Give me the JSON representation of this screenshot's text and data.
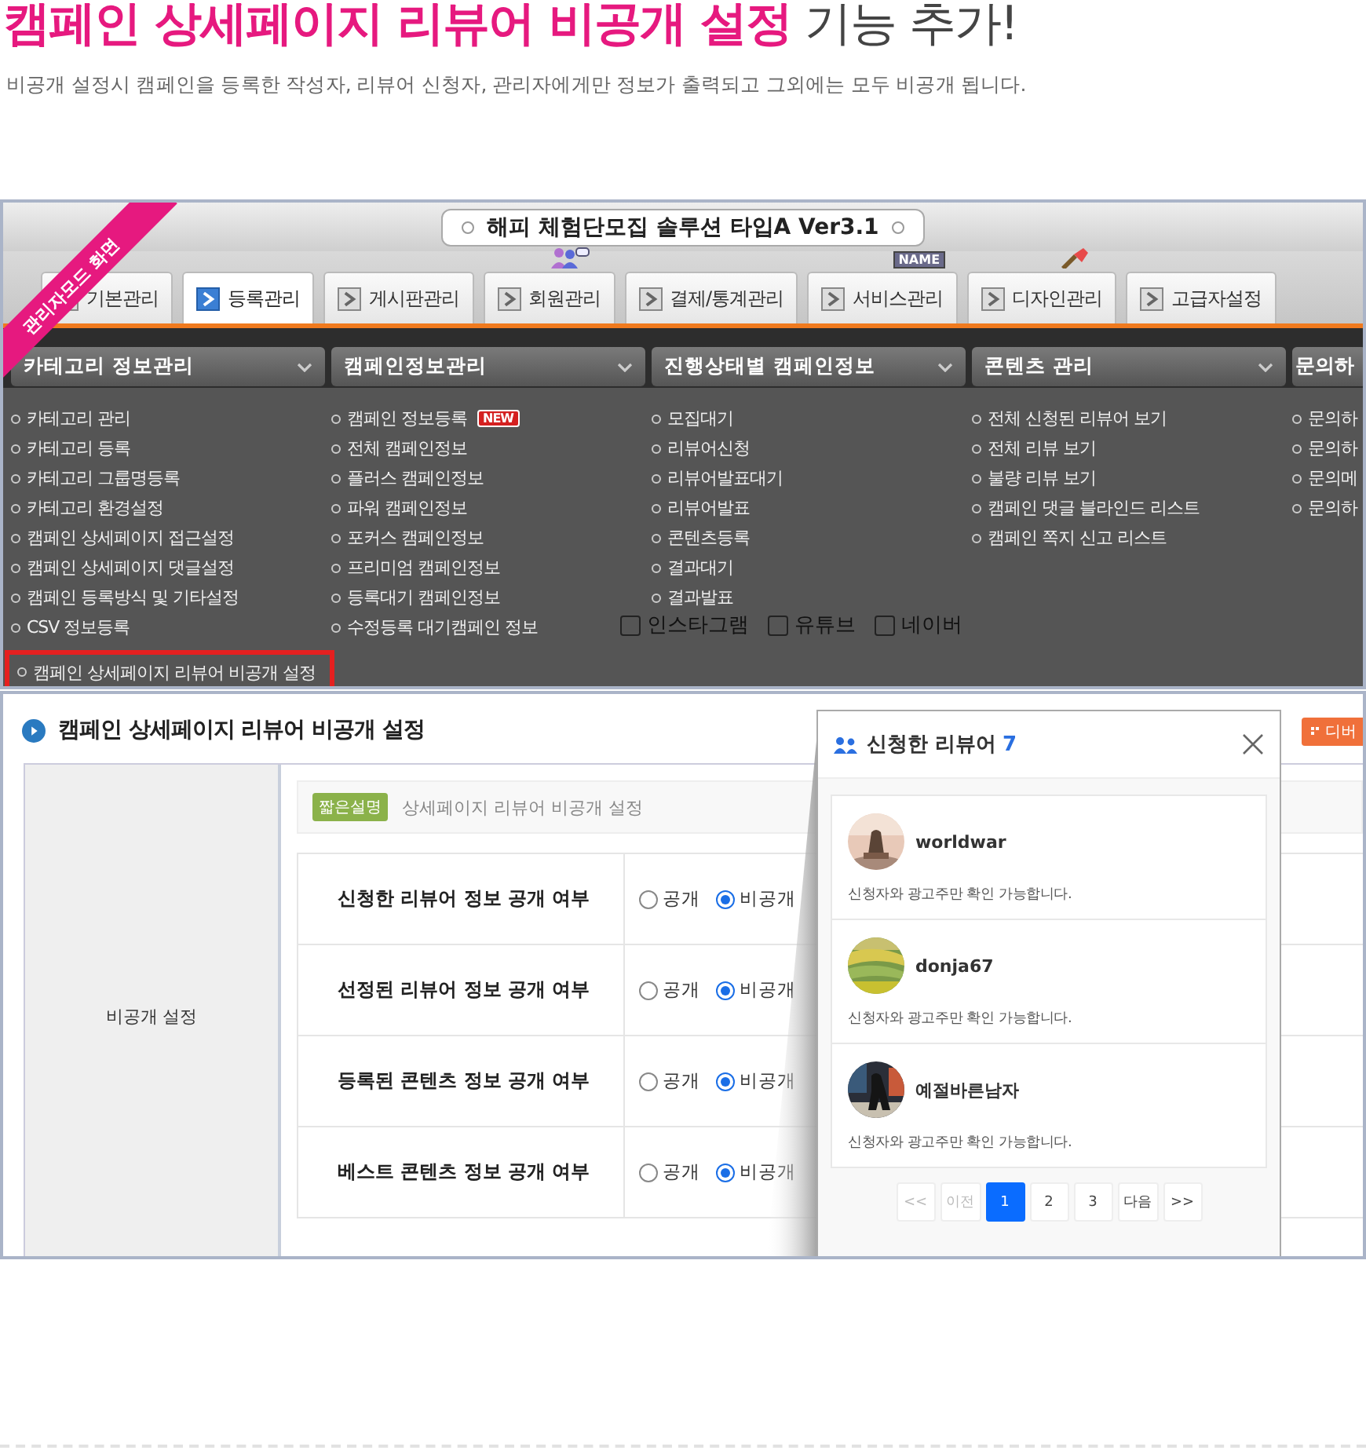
{
  "headline": {
    "highlight": "캠페인 상세페이지 리뷰어 비공개 설정",
    "rest": "기능 추가!"
  },
  "subtitle": "비공개 설정시 캠페인을 등록한 작성자, 리뷰어 신청자, 관리자에게만 정보가 출력되고 그외에는 모두 비공개 됩니다.",
  "admin_screen": {
    "ribbon": "관리자모드 화면",
    "title": "해피 체험단모집 솔루션 타입A Ver3.1",
    "tabs": [
      {
        "label": "기본관리",
        "selected": false
      },
      {
        "label": "등록관리",
        "selected": true
      },
      {
        "label": "게시판관리",
        "selected": false
      },
      {
        "label": "회원관리",
        "selected": false,
        "kind": "people"
      },
      {
        "label": "결제/통계관리",
        "selected": false
      },
      {
        "label": "서비스관리",
        "selected": false,
        "kind": "name_tag",
        "tag": "NAME"
      },
      {
        "label": "디자인관리",
        "selected": false,
        "kind": "brush"
      },
      {
        "label": "고급자설정",
        "selected": false
      }
    ],
    "menu": [
      {
        "heading": "카테고리 정보관리",
        "items": [
          {
            "label": "카테고리 관리",
            "highlighted": false
          },
          {
            "label": "카테고리 등록",
            "highlighted": false
          },
          {
            "label": "카테고리 그룹명등록",
            "highlighted": false
          },
          {
            "label": "카테고리 환경설정",
            "highlighted": false
          },
          {
            "label": "캠페인 상세페이지 접근설정",
            "highlighted": false
          },
          {
            "label": "캠페인 상세페이지 댓글설정",
            "highlighted": false
          },
          {
            "label": "캠페인 등록방식 및 기타설정",
            "highlighted": false
          },
          {
            "label": "CSV 정보등록",
            "highlighted": false
          },
          {
            "label": "캠페인 상세페이지 리뷰어 비공개 설정",
            "highlighted": true
          }
        ]
      },
      {
        "heading": "캠페인정보관리",
        "items": [
          {
            "label": "캠페인 정보등록",
            "highlighted": false,
            "badge": "NEW"
          },
          {
            "label": "전체 캠페인정보",
            "highlighted": false
          },
          {
            "label": "플러스 캠페인정보",
            "highlighted": false
          },
          {
            "label": "파워 캠페인정보",
            "highlighted": false
          },
          {
            "label": "포커스 캠페인정보",
            "highlighted": false
          },
          {
            "label": "프리미엄 캠페인정보",
            "highlighted": false
          },
          {
            "label": "등록대기 캠페인정보",
            "highlighted": false
          },
          {
            "label": "수정등록 대기캠페인 정보",
            "highlighted": false
          }
        ]
      },
      {
        "heading": "진행상태별 캠페인정보",
        "items": [
          {
            "label": "모집대기",
            "highlighted": false
          },
          {
            "label": "리뷰어신청",
            "highlighted": false
          },
          {
            "label": "리뷰어발표대기",
            "highlighted": false
          },
          {
            "label": "리뷰어발표",
            "highlighted": false
          },
          {
            "label": "콘텐츠등록",
            "highlighted": false
          },
          {
            "label": "결과대기",
            "highlighted": false
          },
          {
            "label": "결과발표",
            "highlighted": false
          }
        ]
      },
      {
        "heading": "콘텐츠 관리",
        "items": [
          {
            "label": "전체 신청된 리뷰어 보기",
            "highlighted": false
          },
          {
            "label": "전체 리뷰 보기",
            "highlighted": false
          },
          {
            "label": "불량 리뷰 보기",
            "highlighted": false
          },
          {
            "label": "캠페인 댓글 블라인드 리스트",
            "highlighted": false
          },
          {
            "label": "캠페인 쪽지 신고 리스트",
            "highlighted": false
          }
        ]
      },
      {
        "heading": "문의하",
        "items": [
          {
            "label": "문의하",
            "highlighted": false
          },
          {
            "label": "문의하",
            "highlighted": false
          },
          {
            "label": "문의메",
            "highlighted": false
          },
          {
            "label": "문의하",
            "highlighted": false
          }
        ]
      }
    ],
    "underlay_checkboxes": [
      {
        "label": "인스타그램",
        "checked": false
      },
      {
        "label": "유튜브",
        "checked": false
      },
      {
        "label": "네이버",
        "checked": false
      }
    ]
  },
  "settings_screen": {
    "title": "캠페인 상세페이지 리뷰어 비공개 설정",
    "corner_button": "디버",
    "side_label": "비공개 설정",
    "note_badge": "짧은설명",
    "note": "상세페이지 리뷰어 비공개 설정",
    "rows": [
      {
        "label": "신청한 리뷰어 정보 공개 여부",
        "options": [
          {
            "label": "공개",
            "selected": false
          },
          {
            "label": "비공개",
            "selected": true
          }
        ]
      },
      {
        "label": "선정된 리뷰어 정보 공개 여부",
        "options": [
          {
            "label": "공개",
            "selected": false
          },
          {
            "label": "비공개",
            "selected": true
          }
        ]
      },
      {
        "label": "등록된 콘텐츠 정보 공개 여부",
        "options": [
          {
            "label": "공개",
            "selected": false
          },
          {
            "label": "비공개",
            "selected": true
          }
        ]
      },
      {
        "label": "베스트 콘텐츠 정보 공개 여부",
        "options": [
          {
            "label": "공개",
            "selected": false
          },
          {
            "label": "비공개",
            "selected": true
          }
        ]
      }
    ]
  },
  "popup": {
    "title": "신청한 리뷰어",
    "count": "7",
    "reviewers": [
      {
        "name": "worldwar",
        "note": "신청자와 광고주만 확인 가능합니다."
      },
      {
        "name": "donja67",
        "note": "신청자와 광고주만 확인 가능합니다."
      },
      {
        "name": "예절바른남자",
        "note": "신청자와 광고주만 확인 가능합니다."
      }
    ],
    "pages": [
      {
        "label": "<<",
        "selected": false,
        "disabled": true
      },
      {
        "label": "이전",
        "selected": false,
        "disabled": true
      },
      {
        "label": "1",
        "selected": true,
        "disabled": false
      },
      {
        "label": "2",
        "selected": false,
        "disabled": false
      },
      {
        "label": "3",
        "selected": false,
        "disabled": false
      },
      {
        "label": "다음",
        "selected": false,
        "disabled": false
      },
      {
        "label": ">>",
        "selected": false,
        "disabled": false
      }
    ]
  }
}
